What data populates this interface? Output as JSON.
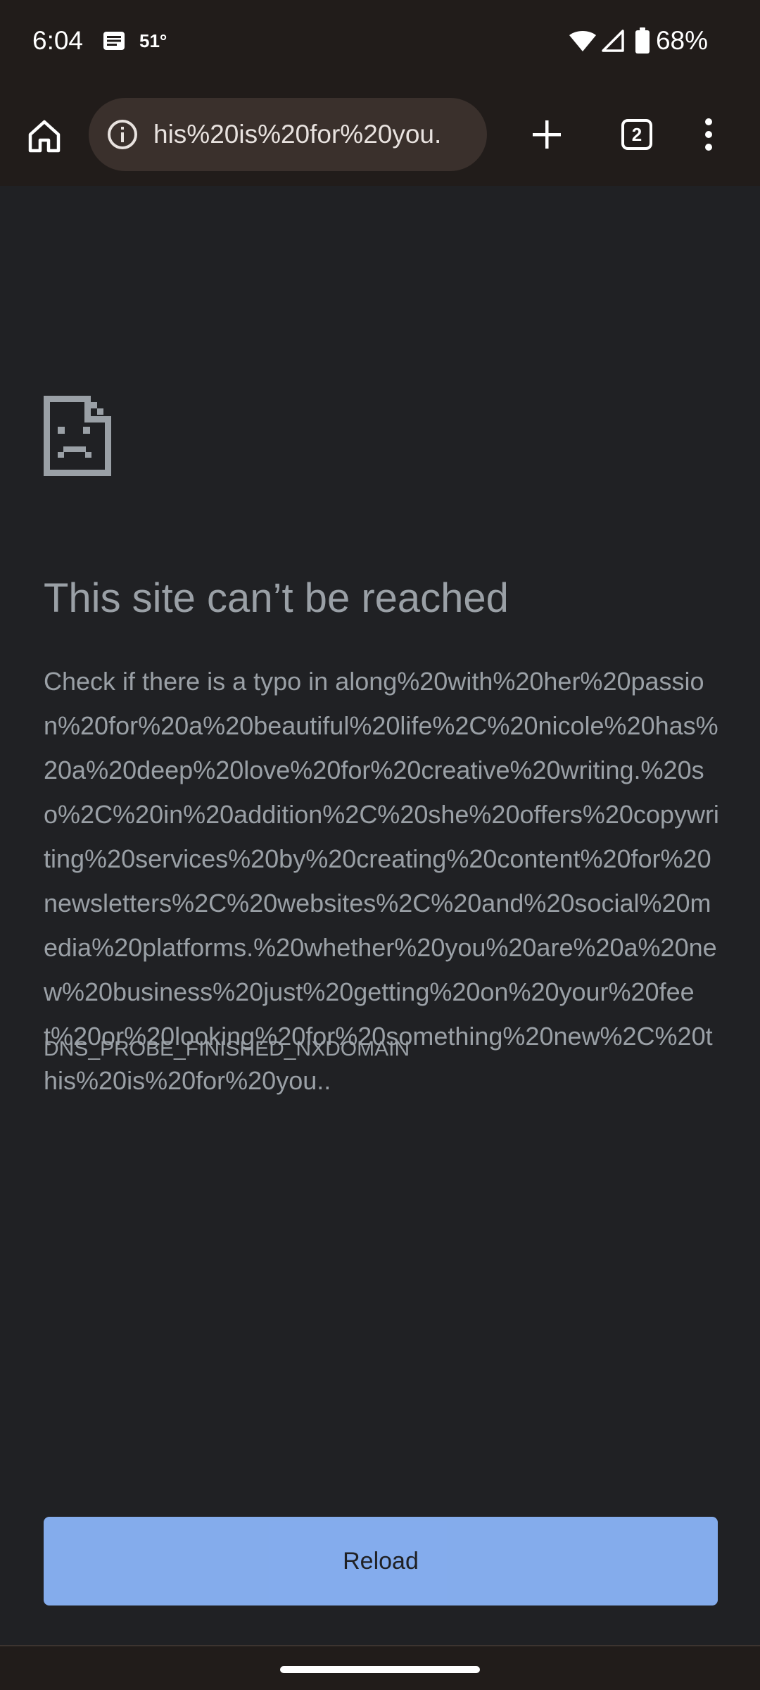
{
  "status_bar": {
    "time": "6:04",
    "temperature": "51°",
    "battery_percent": "68%",
    "icons": [
      "message-icon",
      "wifi-icon",
      "cellular-signal-icon",
      "battery-icon"
    ]
  },
  "toolbar": {
    "url_display": "his%20is%20for%20you.",
    "tab_count": "2",
    "icons": [
      "home-icon",
      "info-icon",
      "plus-icon",
      "tab-switcher-icon",
      "more-vert-icon"
    ]
  },
  "error_page": {
    "icon": "sad-page-icon",
    "title": "This site can’t be reached",
    "body": "Check if there is a typo in along%20with%20her%20passion%20for%20a%20beautiful%20life%2C%20nicole%20has%20a%20deep%20love%20for%20creative%20writing.%20so%2C%20in%20addition%2C%20she%20offers%20copywriting%20services%20by%20creating%20content%20for%20newsletters%2C%20websites%2C%20and%20social%20media%20platforms.%20whether%20you%20are%20a%20new%20business%20just%20getting%20on%20your%20feet%20or%20looking%20for%20something%20new%2C%20this%20is%20for%20you..",
    "error_code": "DNS_PROBE_FINISHED_NXDOMAIN",
    "reload_label": "Reload"
  },
  "colors": {
    "background": "#202124",
    "chrome_bar": "#211c1a",
    "omnibox": "#3a302c",
    "text_muted": "#9aa0a6",
    "button_accent": "#8ab4f8"
  }
}
